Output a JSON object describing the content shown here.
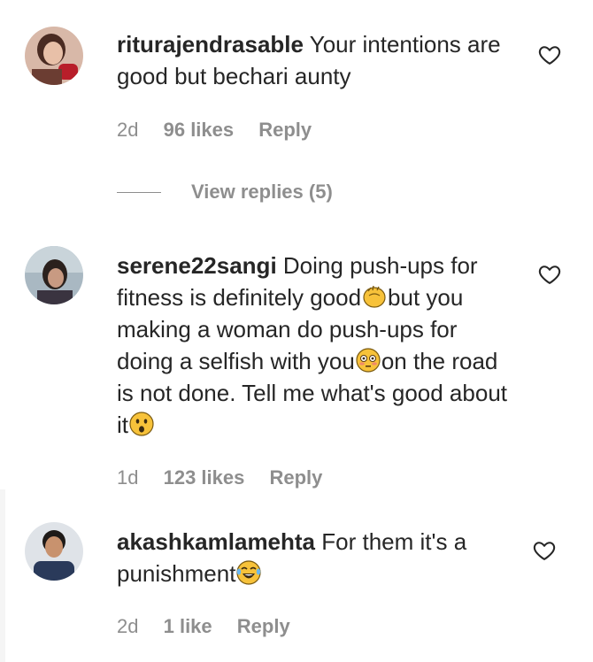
{
  "comments": [
    {
      "username": "riturajendrasable",
      "text": "Your intentions are good but bechari aunty",
      "time": "2d",
      "likes": "96 likes",
      "reply": "Reply",
      "view_replies": "View replies (5)"
    },
    {
      "username": "serene22sangi",
      "text_1": "Doing push-ups for fitness is definitely good",
      "text_2": "but you making a woman do push-ups for doing a selfish with you",
      "text_3": "on the road is not done. Tell me what's good about it",
      "time": "1d",
      "likes": "123 likes",
      "reply": "Reply"
    },
    {
      "username": "akashkamlamehta",
      "text": "For them it's a punishment",
      "time": "2d",
      "likes": "1 like",
      "reply": "Reply"
    }
  ],
  "colors": {
    "text": "#262626",
    "meta": "#8e8e8e",
    "emoji_yellow": "#f7c23a"
  },
  "icons": {
    "like": "heart-outline-icon",
    "emoji_1": "clapping-hands-emoji",
    "emoji_2": "flushed-face-emoji",
    "emoji_3": "astonished-face-emoji",
    "emoji_4": "tears-of-joy-emoji"
  }
}
